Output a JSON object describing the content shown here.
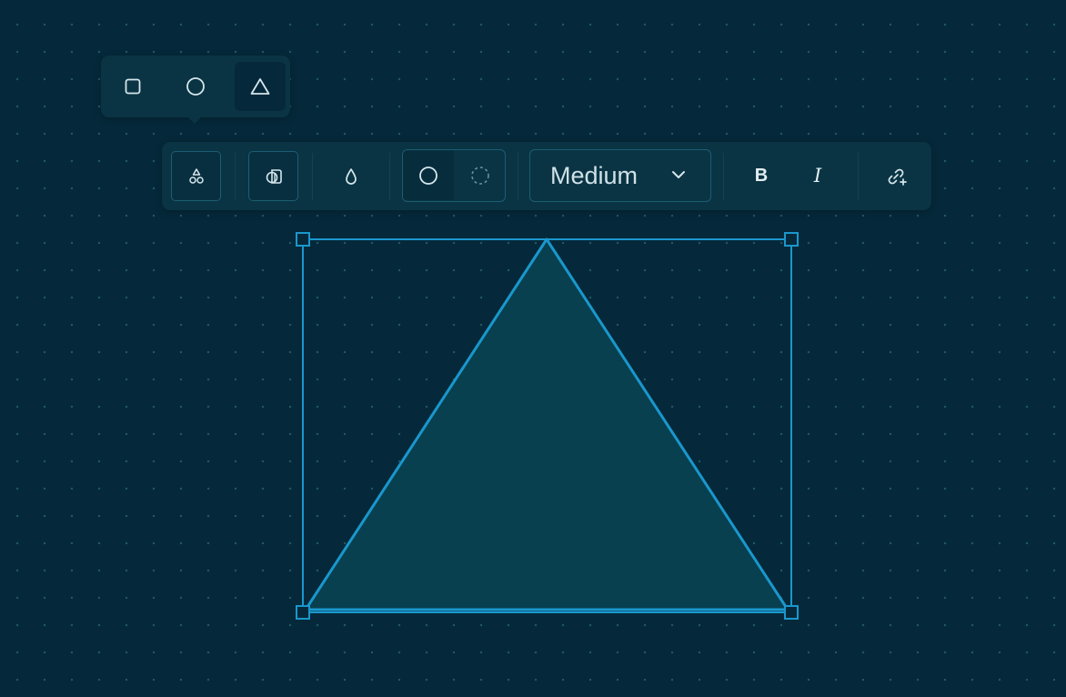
{
  "shape_picker": {
    "options": [
      {
        "name": "square",
        "selected": false
      },
      {
        "name": "circle",
        "selected": false
      },
      {
        "name": "triangle",
        "selected": true
      }
    ]
  },
  "toolbar": {
    "buttons": [
      {
        "name": "shapes-icon",
        "boxed": true
      },
      {
        "name": "layers-icon",
        "boxed": true
      },
      {
        "name": "fill-drop-icon",
        "boxed": false
      }
    ],
    "stroke_style": {
      "options": [
        "solid-circle-icon",
        "dashed-circle-icon"
      ],
      "active": "solid-circle-icon"
    },
    "size_label": "Medium",
    "bold_label": "B",
    "italic_label": "I",
    "link_icon": "link-add-icon"
  },
  "selected_shape": {
    "type": "triangle",
    "fill_color": "#08404f",
    "stroke_color": "#1a97cd"
  },
  "colors": {
    "canvas_bg": "#05293a",
    "panel_bg": "#0a3444",
    "accent": "#1a97cd",
    "icon": "#d6e6ec"
  }
}
